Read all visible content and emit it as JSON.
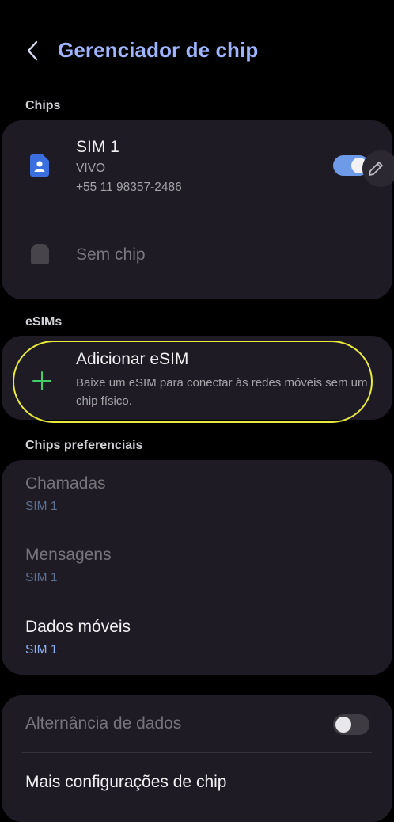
{
  "header": {
    "title": "Gerenciador de chip"
  },
  "sections": {
    "chips": "Chips",
    "esims": "eSIMs",
    "preferred": "Chips preferenciais"
  },
  "sim1": {
    "name": "SIM 1",
    "carrier": "VIVO",
    "number": "+55 11 98357-2486",
    "enabled": true
  },
  "no_sim": {
    "label": "Sem chip"
  },
  "esim": {
    "title": "Adicionar eSIM",
    "description": "Baixe um eSIM para conectar às redes móveis sem um chip físico."
  },
  "preferred": {
    "calls": {
      "title": "Chamadas",
      "value": "SIM 1"
    },
    "messages": {
      "title": "Mensagens",
      "value": "SIM 1"
    },
    "mobile_data": {
      "title": "Dados móveis",
      "value": "SIM 1"
    }
  },
  "data_switch": {
    "label": "Alternância de dados",
    "enabled": false
  },
  "more_settings": {
    "label": "Mais configurações de chip"
  },
  "colors": {
    "accent": "#9fb4ff",
    "toggle_on": "#6e9be8",
    "plus": "#3fcf6a",
    "highlight": "#e9ea3c"
  }
}
